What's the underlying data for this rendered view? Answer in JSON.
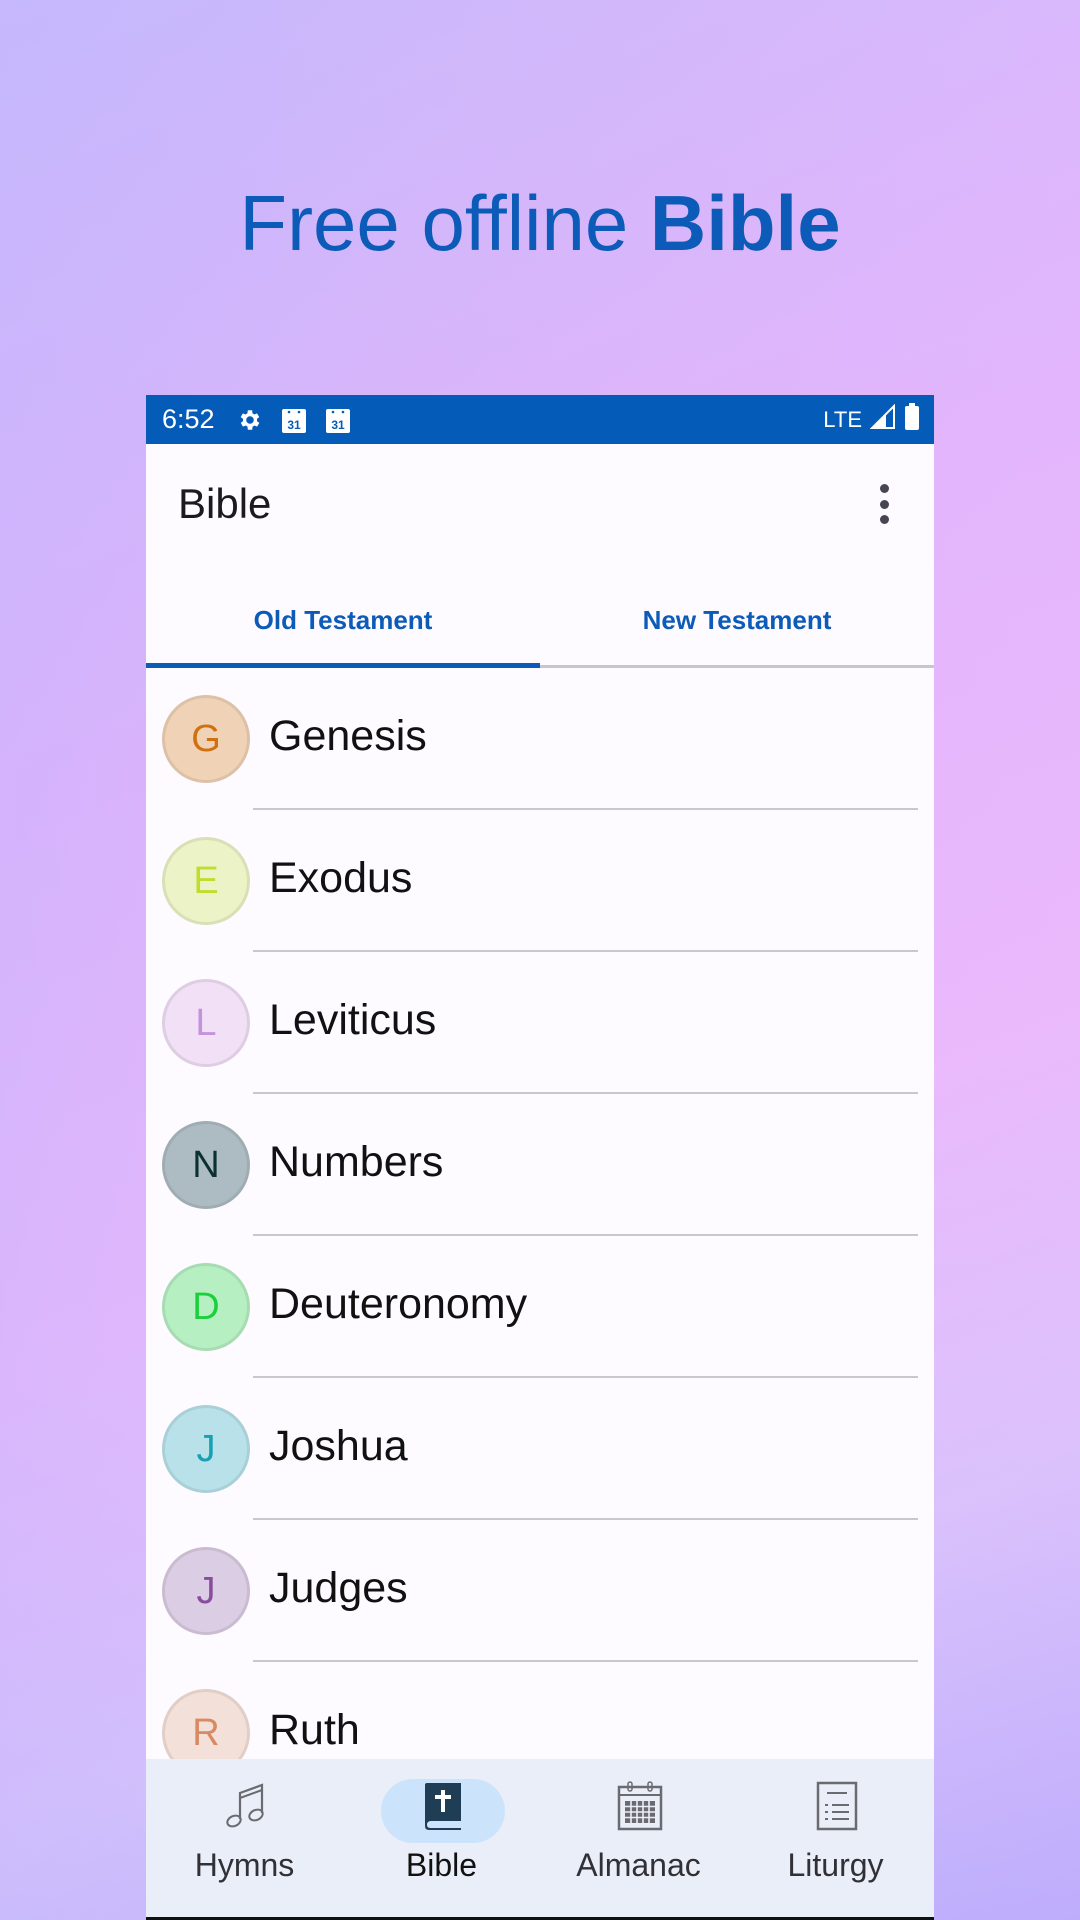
{
  "promo": {
    "headline_regular": "Free offline ",
    "headline_bold": "Bible",
    "headline_color": "#0c5bb8"
  },
  "status_bar": {
    "time": "6:52",
    "left_icons": [
      "settings-icon",
      "calendar-icon",
      "calendar-icon"
    ],
    "calendar_day": "31",
    "network": "LTE",
    "right_icons": [
      "signal-icon",
      "battery-icon"
    ],
    "background": "#055cb8"
  },
  "app_bar": {
    "title": "Bible",
    "menu_icon": "more-vert-icon"
  },
  "tabs": [
    {
      "label": "Old Testament",
      "selected": true
    },
    {
      "label": "New Testament",
      "selected": false
    }
  ],
  "books": [
    {
      "initial": "G",
      "name": "Genesis",
      "bg": "#f0d2b6",
      "fg": "#d0700f"
    },
    {
      "initial": "E",
      "name": "Exodus",
      "bg": "#ecf3c6",
      "fg": "#c0dd2f"
    },
    {
      "initial": "L",
      "name": "Leviticus",
      "bg": "#f1e0f6",
      "fg": "#c493dc"
    },
    {
      "initial": "N",
      "name": "Numbers",
      "bg": "#adbcc3",
      "fg": "#0b3130"
    },
    {
      "initial": "D",
      "name": "Deuteronomy",
      "bg": "#b6efc2",
      "fg": "#1bcf3d"
    },
    {
      "initial": "J",
      "name": "Joshua",
      "bg": "#b8e1ea",
      "fg": "#16a1b3"
    },
    {
      "initial": "J",
      "name": "Judges",
      "bg": "#dbcde3",
      "fg": "#8a4c9f"
    },
    {
      "initial": "R",
      "name": "Ruth",
      "bg": "#f3e0d8",
      "fg": "#d88a63"
    }
  ],
  "bottom_nav": [
    {
      "label": "Hymns",
      "icon": "music-note-icon",
      "active": false
    },
    {
      "label": "Bible",
      "icon": "bible-icon",
      "active": true
    },
    {
      "label": "Almanac",
      "icon": "calendar-icon",
      "active": false
    },
    {
      "label": "Liturgy",
      "icon": "document-list-icon",
      "active": false
    }
  ]
}
